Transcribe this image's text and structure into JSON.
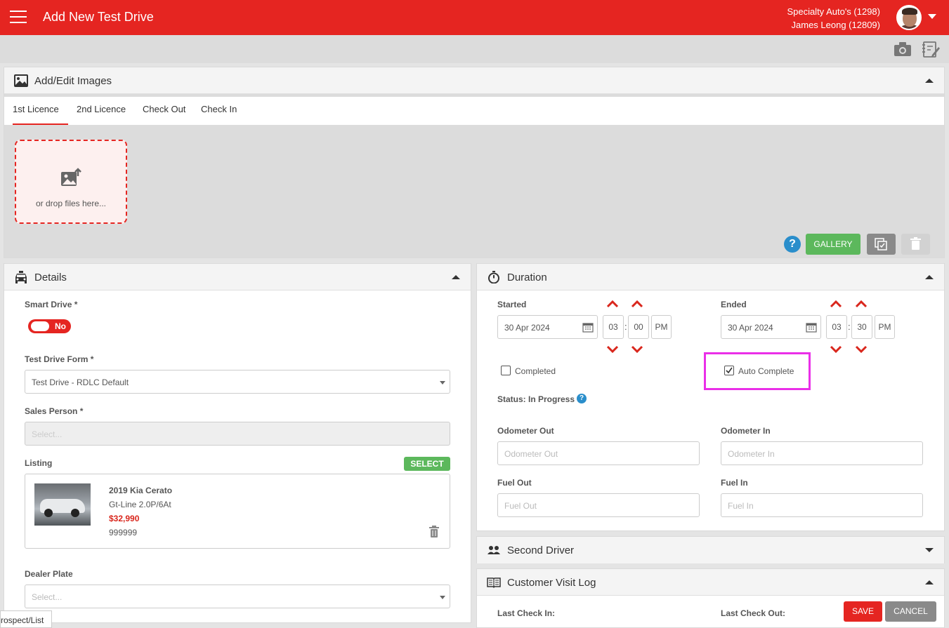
{
  "header": {
    "title": "Add New Test Drive",
    "dealer": "Specialty Auto's (1298)",
    "user": "James Leong (12809)"
  },
  "images_panel": {
    "title": "Add/Edit Images",
    "tabs": [
      "1st Licence",
      "2nd Licence",
      "Check Out",
      "Check In"
    ],
    "active_tab": "1st Licence",
    "dropzone_text": "or drop files here...",
    "help_symbol": "?",
    "gallery_label": "GALLERY"
  },
  "details": {
    "title": "Details",
    "smart_drive_label": "Smart Drive *",
    "smart_drive_value": "No",
    "form_label": "Test Drive Form *",
    "form_value": "Test Drive - RDLC Default",
    "sales_label": "Sales Person *",
    "sales_placeholder": "Select...",
    "listing_label": "Listing",
    "select_label": "SELECT",
    "listing": {
      "title": "2019 Kia Cerato",
      "subtitle": "Gt-Line 2.0P/6At",
      "price": "$32,990",
      "stock": "999999"
    },
    "dealer_plate_label": "Dealer Plate",
    "dealer_plate_placeholder": "Select..."
  },
  "duration": {
    "title": "Duration",
    "started_label": "Started",
    "started_date": "30 Apr 2024",
    "started_hour": "03",
    "started_min": "00",
    "started_ampm": "PM",
    "ended_label": "Ended",
    "ended_date": "30 Apr 2024",
    "ended_hour": "03",
    "ended_min": "30",
    "ended_ampm": "PM",
    "time_sep": ":",
    "completed_label": "Completed",
    "completed_checked": false,
    "auto_complete_label": "Auto Complete",
    "auto_complete_checked": true,
    "status_text": "Status: In Progress",
    "help_symbol": "?",
    "odo_out_label": "Odometer Out",
    "odo_out_placeholder": "Odometer Out",
    "odo_in_label": "Odometer In",
    "odo_in_placeholder": "Odometer In",
    "fuel_out_label": "Fuel Out",
    "fuel_out_placeholder": "Fuel Out",
    "fuel_in_label": "Fuel In",
    "fuel_in_placeholder": "Fuel In"
  },
  "second_driver": {
    "title": "Second Driver"
  },
  "visit_log": {
    "title": "Customer Visit Log",
    "last_check_in_label": "Last Check In:",
    "last_check_out_label": "Last Check Out:"
  },
  "actions": {
    "save_label": "SAVE",
    "cancel_label": "CANCEL"
  },
  "status_bar": {
    "url_fragment": "rospect/List"
  },
  "colors": {
    "brand": "#e52521",
    "green": "#5cb85c",
    "highlight": "#ea2fe8"
  }
}
